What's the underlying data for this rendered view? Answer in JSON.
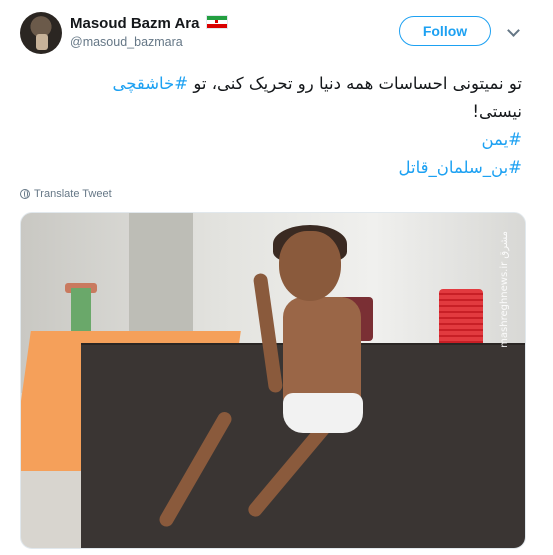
{
  "header": {
    "display_name": "Masoud Bazm Ara",
    "handle": "@masoud_bazmara",
    "follow_label": "Follow",
    "flag_icon": "iran-flag-icon"
  },
  "tweet": {
    "line1_text": "تو نمیتونی احساسات همه دنیا رو تحریک کنی، تو ",
    "line1_hashtag": "#خاشقچی",
    "line2_text": "نیستی!",
    "hashtag_2": "#یمن",
    "hashtag_3": "#بن_سلمان_قاتل"
  },
  "translate_label": "Translate Tweet",
  "photo": {
    "watermark_text": "mashreghnews.ir مشرق"
  },
  "colors": {
    "accent": "#1da1f2",
    "text": "#14171a",
    "muted": "#657786"
  }
}
